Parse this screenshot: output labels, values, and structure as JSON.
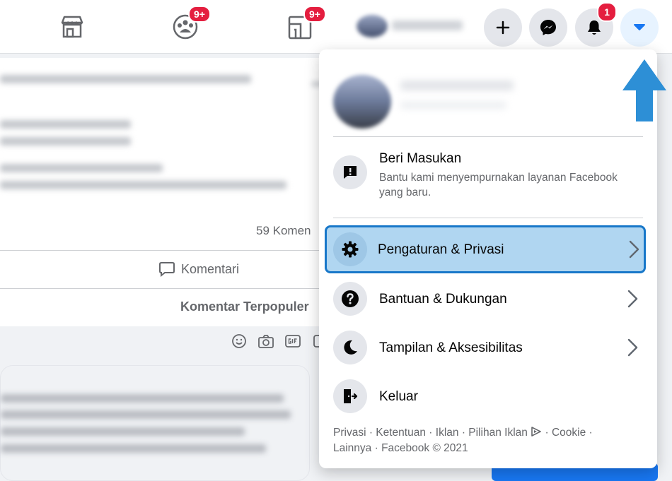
{
  "topbar": {
    "nav_icons": [
      {
        "name": "marketplace-icon",
        "badge": ""
      },
      {
        "name": "groups-icon",
        "badge": "9+"
      },
      {
        "name": "gaming-icon",
        "badge": "9+"
      }
    ],
    "actions": [
      {
        "name": "create-icon"
      },
      {
        "name": "messenger-icon"
      },
      {
        "name": "notifications-icon",
        "badge": "1"
      },
      {
        "name": "account-menu-icon"
      }
    ]
  },
  "feed": {
    "comment_count": "59 Komen",
    "comment_action": "Komentari",
    "sort_label": "Komentar Terpopuler"
  },
  "menu": {
    "feedback": {
      "title": "Beri Masukan",
      "subtitle": "Bantu kami menyempurnakan layanan Facebook yang baru."
    },
    "items": [
      {
        "label": "Pengaturan & Privasi",
        "icon": "gear-icon"
      },
      {
        "label": "Bantuan & Dukungan",
        "icon": "help-icon"
      },
      {
        "label": "Tampilan & Aksesibilitas",
        "icon": "moon-icon"
      },
      {
        "label": "Keluar",
        "icon": "logout-icon"
      }
    ],
    "footer": {
      "privacy": "Privasi",
      "terms": "Ketentuan",
      "ads": "Iklan",
      "ad_choices": "Pilihan Iklan",
      "cookies": "Cookie",
      "more": "Lainnya",
      "copyright": "Facebook © 2021"
    }
  },
  "colors": {
    "accent": "#1877f2",
    "highlight_bg": "#b0d6f1",
    "highlight_border": "#1877c9",
    "badge": "#e41e3f",
    "annotation_arrow": "#2d8fd6"
  }
}
